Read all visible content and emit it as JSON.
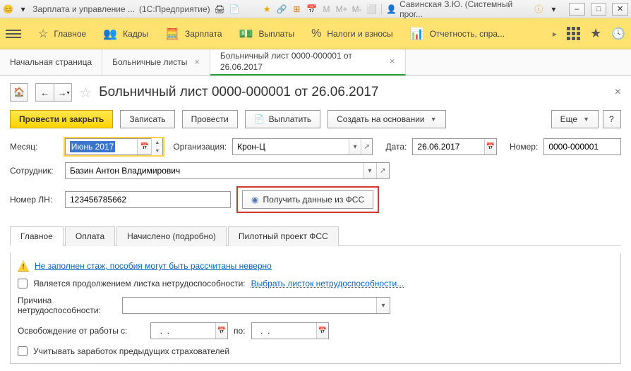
{
  "titlebar": {
    "app_title": "Зарплата и управление ...",
    "app_suffix": "(1С:Предприятие)",
    "user_name": "Савинская З.Ю. (Системный прог..."
  },
  "yellow_toolbar": {
    "items": [
      "Главное",
      "Кадры",
      "Зарплата",
      "Выплаты",
      "Налоги и взносы",
      "Отчетность, спра..."
    ]
  },
  "page_tabs": [
    {
      "label": "Начальная страница",
      "closable": false
    },
    {
      "label": "Больничные листы",
      "closable": true
    },
    {
      "label": "Больничный лист 0000-000001 от 26.06.2017",
      "closable": true,
      "active": true
    }
  ],
  "doc": {
    "title": "Больничный лист 0000-000001 от 26.06.2017"
  },
  "actions": {
    "run_close": "Провести и закрыть",
    "write": "Записать",
    "run": "Провести",
    "pay": "Выплатить",
    "create_based": "Создать на основании",
    "more": "Еще",
    "help": "?"
  },
  "form": {
    "month_label": "Месяц:",
    "month_value": "Июнь 2017",
    "org_label": "Организация:",
    "org_value": "Крон-Ц",
    "date_label": "Дата:",
    "date_value": "26.06.2017",
    "number_label": "Номер:",
    "number_value": "0000-000001",
    "employee_label": "Сотрудник:",
    "employee_value": "Базин Антон Владимирович",
    "ln_label": "Номер ЛН:",
    "ln_value": "123456785662",
    "fss_button": "Получить данные из ФСС"
  },
  "inner_tabs": [
    "Главное",
    "Оплата",
    "Начислено (подробно)",
    "Пилотный проект ФСС"
  ],
  "tab_body": {
    "warning_text": "Не заполнен стаж, пособия могут быть рассчитаны неверно",
    "continuation_label": "Является продолжением листка нетрудоспособности:",
    "continuation_link": "Выбрать листок нетрудоспособности...",
    "reason_label": "Причина нетрудоспособности:",
    "release_label": "Освобождение от работы с:",
    "release_value": "  .  .    ",
    "release_to": "по:",
    "release_to_value": "  .  .    ",
    "prev_insurers": "Учитывать заработок предыдущих страхователей"
  }
}
